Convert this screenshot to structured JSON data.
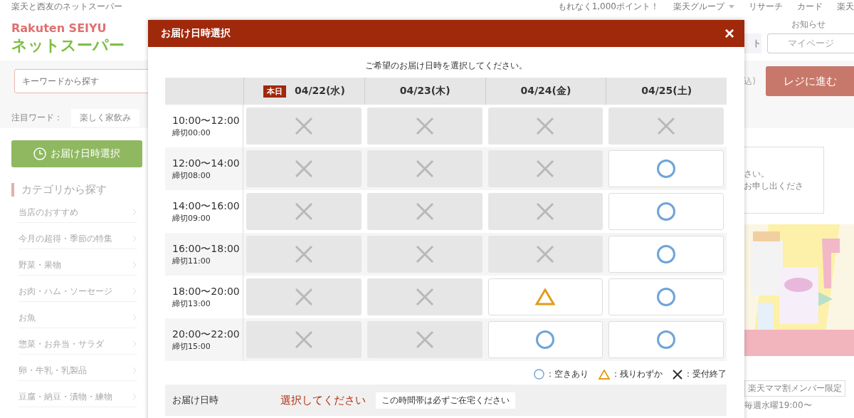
{
  "top_bar": {
    "tagline": "楽天と西友のネットスーパー",
    "links": [
      "もれなく1,000ポイント！",
      "楽天グループ",
      "リサーチ",
      "カード",
      "楽天"
    ]
  },
  "logo": {
    "brand": "Rakuten  SEIYU",
    "name": "ネットスーパー"
  },
  "header": {
    "notice": "お知らせ",
    "partial_button": "ト",
    "mypage": "マイページ"
  },
  "search": {
    "placeholder": "キーワードから探す",
    "partial_text": "込)",
    "checkout": "レジに進む"
  },
  "trending": {
    "label": "注目ワード：",
    "tags": [
      "楽しく家飲み"
    ]
  },
  "sidebar": {
    "delivery_button": "お届け日時選択",
    "heading": "カテゴリから探す",
    "items": [
      "当店のおすすめ",
      "今月の超得・季節の特集",
      "野菜・果物",
      "お肉・ハム・ソーセージ",
      "お魚",
      "惣菜・お弁当・サラダ",
      "卵・牛乳・乳製品",
      "豆腐・納豆・漬物・練物"
    ]
  },
  "right_panel": {
    "notice_lines": [
      "さい。",
      "お申し出くださ"
    ],
    "banner": {
      "kind": "picture"
    },
    "member_tag": "楽天ママ割メンバー限定",
    "schedule": "毎週水曜19:00〜"
  },
  "modal": {
    "title": "お届け日時選択",
    "close": "×",
    "instruction": "ご希望のお届け日時を選択してください。",
    "columns": [
      {
        "badge": "本日",
        "date": "04/22(水)"
      },
      {
        "date": "04/23(木)"
      },
      {
        "date": "04/24(金)"
      },
      {
        "date": "04/25(土)"
      }
    ],
    "rows": [
      {
        "time": "10:00〜12:00",
        "deadline": "締切00:00",
        "slots": [
          {
            "kind": "closed"
          },
          {
            "kind": "closed"
          },
          {
            "kind": "closed"
          },
          {
            "kind": "closed"
          }
        ]
      },
      {
        "time": "12:00〜14:00",
        "deadline": "締切08:00",
        "slots": [
          {
            "kind": "closed"
          },
          {
            "kind": "closed"
          },
          {
            "kind": "closed"
          },
          {
            "kind": "available"
          }
        ]
      },
      {
        "time": "14:00〜16:00",
        "deadline": "締切09:00",
        "slots": [
          {
            "kind": "closed"
          },
          {
            "kind": "closed"
          },
          {
            "kind": "closed"
          },
          {
            "kind": "available"
          }
        ]
      },
      {
        "time": "16:00〜18:00",
        "deadline": "締切11:00",
        "slots": [
          {
            "kind": "closed"
          },
          {
            "kind": "closed"
          },
          {
            "kind": "closed"
          },
          {
            "kind": "available"
          }
        ]
      },
      {
        "time": "18:00〜20:00",
        "deadline": "締切13:00",
        "slots": [
          {
            "kind": "closed"
          },
          {
            "kind": "closed"
          },
          {
            "kind": "few"
          },
          {
            "kind": "available"
          }
        ]
      },
      {
        "time": "20:00〜22:00",
        "deadline": "締切15:00",
        "slots": [
          {
            "kind": "closed"
          },
          {
            "kind": "closed"
          },
          {
            "kind": "available"
          },
          {
            "kind": "available"
          }
        ]
      }
    ],
    "legend": [
      {
        "kind": "available",
        "label": "：空きあり"
      },
      {
        "kind": "few",
        "label": "：残りわずか"
      },
      {
        "kind": "closed",
        "label": "：受付終了"
      }
    ],
    "footer": {
      "label": "お届け日時",
      "value": "選択してください",
      "note": "この時間帯は必ずご在宅ください"
    }
  }
}
